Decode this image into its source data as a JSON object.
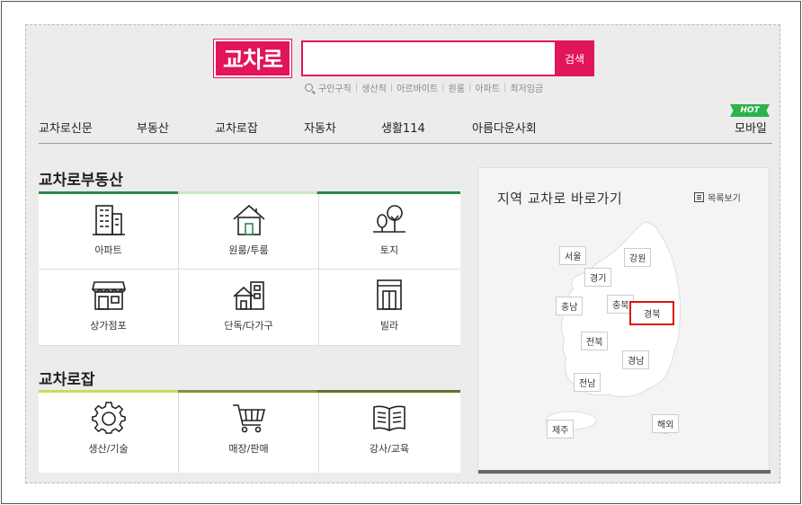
{
  "header": {
    "logo_text": "교차로",
    "search_button": "검색",
    "search_value": "",
    "keywords": [
      "구인구직",
      "생산직",
      "아르바이트",
      "원룸",
      "아파트",
      "최저임금"
    ]
  },
  "nav": {
    "items": [
      "교차로신문",
      "부동산",
      "교차로잡",
      "자동차",
      "생활114",
      "아름다운사회",
      "모바일"
    ],
    "hot_badge": "HOT"
  },
  "realestate": {
    "title": "교차로부동산",
    "items": [
      "아파트",
      "원룸/투룸",
      "토지",
      "상가점포",
      "단독/다가구",
      "빌라"
    ]
  },
  "jobs": {
    "title": "교차로잡",
    "items": [
      "생산/기술",
      "매장/판매",
      "강사/교육"
    ]
  },
  "region_panel": {
    "title": "지역 교차로 바로가기",
    "list_view": "목록보기",
    "selected": "경북",
    "regions": [
      "서울",
      "강원",
      "경기",
      "충남",
      "충북",
      "경북",
      "전북",
      "경남",
      "전남",
      "제주",
      "해외"
    ]
  },
  "colors": {
    "brand": "#e2155a",
    "green": "#2eb24b",
    "selected_border": "#dd1111"
  }
}
